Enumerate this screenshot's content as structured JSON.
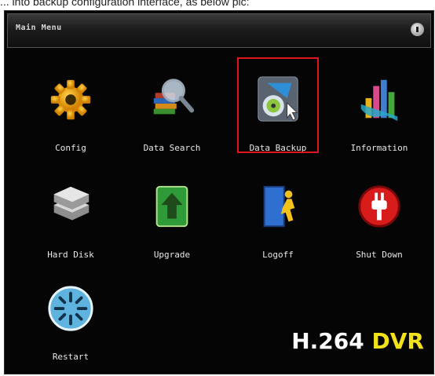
{
  "caption": "... into backup configuration interface, as below pic:",
  "menu": {
    "title": "Main Menu",
    "items": [
      {
        "label": "Config",
        "icon": "gear-icon"
      },
      {
        "label": "Data Search",
        "icon": "search-icon"
      },
      {
        "label": "Data Backup",
        "icon": "backup-icon"
      },
      {
        "label": "Information",
        "icon": "information-icon"
      },
      {
        "label": "Hard Disk",
        "icon": "hard-disk-icon"
      },
      {
        "label": "Upgrade",
        "icon": "upgrade-icon"
      },
      {
        "label": "Logoff",
        "icon": "logoff-icon"
      },
      {
        "label": "Shut Down",
        "icon": "shutdown-icon"
      },
      {
        "label": "Restart",
        "icon": "restart-icon"
      }
    ],
    "selected_index": 2
  },
  "brand": {
    "part1": "H.264",
    "part2": "DVR"
  },
  "colors": {
    "accent": "#e0151b",
    "brand_yellow": "#f2e21a",
    "background": "#050505"
  }
}
